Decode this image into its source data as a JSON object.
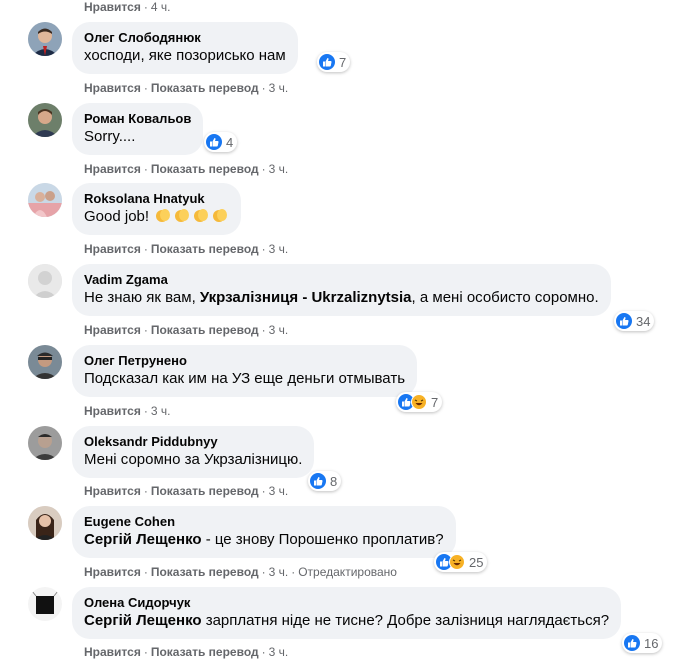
{
  "actions": {
    "like": "Нравится",
    "translate": "Показать перевод",
    "dot": "·",
    "edited": "Отредактировано"
  },
  "top_time": "4 ч.",
  "comments": [
    {
      "author": "Олег Слободянюк",
      "text": "хосподи, яке позорисько нам",
      "count": "7",
      "time": "3 ч."
    },
    {
      "author": "Роман Ковальов",
      "text": "Sorry....",
      "count": "4",
      "time": "3 ч."
    },
    {
      "author": "Roksolana Hnatyuk",
      "text": "Good job!",
      "time": "3 ч."
    },
    {
      "author": "Vadim Zgama",
      "text_pre": "Не знаю як вам, ",
      "mention": "Укрзалізниця - Ukrzaliznytsia",
      "text_post": ", а мені особисто соромно.",
      "count": "34",
      "time": "3 ч."
    },
    {
      "author": "Олег Петрунено",
      "text": "Подсказал как им на УЗ еще деньги отмывать",
      "count": "7",
      "time": "3 ч."
    },
    {
      "author": "Oleksandr Piddubnyy",
      "text": "Мені соромно за Укрзалізницю.",
      "count": "8",
      "time": "3 ч."
    },
    {
      "author": "Eugene Cohen",
      "mention": "Сергій Лещенко",
      "text_post": " - це знову Порошенко проплатив?",
      "count": "25",
      "time": "3 ч."
    },
    {
      "author": "Олена Сидорчук",
      "mention": "Сергій Лещенко",
      "text_post": " зарплатня ніде не тисне? Добре залізниця наглядається?",
      "count": "16",
      "time": "3 ч."
    }
  ],
  "colors": {
    "like": "#1877f2",
    "haha": "#f7b125",
    "bubble": "#f0f2f5",
    "meta": "#65676b"
  }
}
